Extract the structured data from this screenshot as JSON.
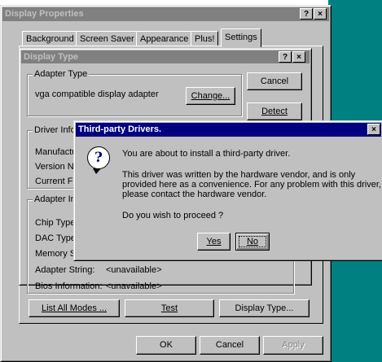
{
  "display_properties": {
    "title": "Display Properties",
    "help_glyph": "?",
    "close_glyph": "×",
    "tabs": [
      "Background",
      "Screen Saver",
      "Appearance",
      "Plus!",
      "Settings"
    ],
    "buttons": {
      "list_all_modes": "List All Modes ...",
      "test": "Test",
      "display_type": "Display Type...",
      "ok": "OK",
      "cancel": "Cancel",
      "apply": "Apply"
    }
  },
  "display_type": {
    "title": "Display Type",
    "help_glyph": "?",
    "close_glyph": "×",
    "adapter_type_legend": "Adapter Type",
    "adapter_name": "vga compatible display adapter",
    "change_button": "Change...",
    "cancel_button": "Cancel",
    "detect_button": "Detect",
    "driver_info_legend": "Driver Info",
    "driver_fields": [
      "Manufacturer",
      "Version Number",
      "Current Files"
    ],
    "adapter_info_legend": "Adapter Information",
    "adapter_fields": [
      "Chip Type",
      "DAC Type",
      "Memory Size"
    ],
    "adapter_string_label": "Adapter String:",
    "adapter_string_value": "<unavailable>",
    "bios_label": "Bios Information:",
    "bios_value": "<unavailable>"
  },
  "third_party": {
    "title": "Third-party Drivers.",
    "close_glyph": "×",
    "icon": "question-icon",
    "line1": "You are about to install a third-party driver.",
    "line2": "This driver was written by the hardware vendor, and is only provided here as a convenience.  For any problem with this driver, please contact the hardware vendor.",
    "line3": "Do you wish to proceed ?",
    "yes": "Yes",
    "no": "No"
  },
  "colors": {
    "desktop": "#008080",
    "active_title": "#000080",
    "inactive_title": "#808080",
    "face": "#c0c0c0"
  }
}
